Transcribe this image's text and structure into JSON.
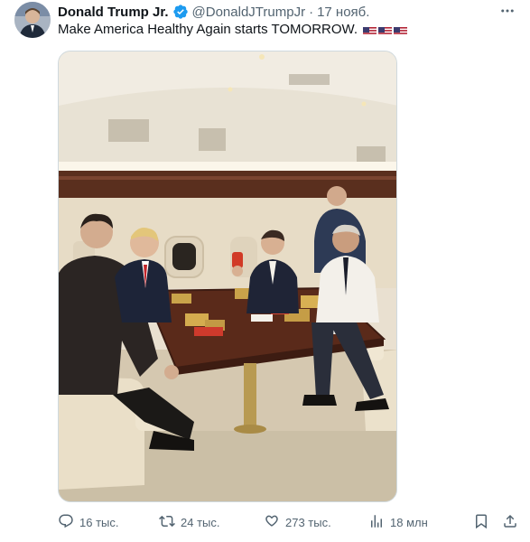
{
  "author": {
    "display_name": "Donald Trump Jr.",
    "handle": "@DonaldJTrumpJr",
    "separator": "·",
    "timestamp": "17 нояб."
  },
  "tweet": {
    "text": "Make America Healthy Again starts TOMORROW.",
    "flags": [
      "us-flag-icon",
      "us-flag-icon",
      "us-flag-icon"
    ]
  },
  "icons": {
    "verified": "verified-badge-icon",
    "more": "more-icon",
    "reply": "reply-icon",
    "retweet": "retweet-icon",
    "like": "like-icon",
    "views": "views-icon",
    "bookmark": "bookmark-icon",
    "share": "share-icon"
  },
  "actions": {
    "replies": "16 тыс.",
    "retweets": "24 тыс.",
    "likes": "273 тыс.",
    "views": "18 млн"
  },
  "colors": {
    "verified": "#1d9bf0",
    "text": "#0f1419",
    "secondary": "#536471"
  }
}
